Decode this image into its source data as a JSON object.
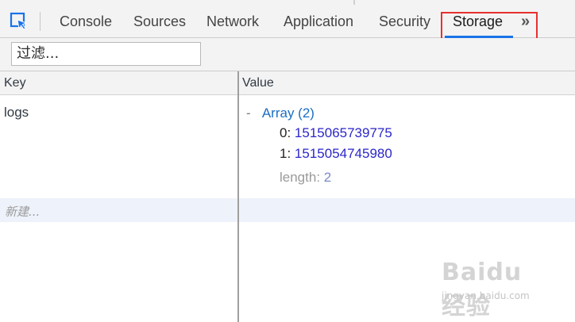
{
  "toolbar": {
    "tabs": [
      {
        "label": "Console"
      },
      {
        "label": "Sources"
      },
      {
        "label": "Network"
      },
      {
        "label": "Application"
      },
      {
        "label": "Security"
      },
      {
        "label": "Storage"
      }
    ],
    "active_tab": "Storage",
    "more_icon": "chevron-double-right-icon",
    "highlight_color": "#e8312f",
    "accent_color": "#1a73e8"
  },
  "filter": {
    "placeholder": "过滤..."
  },
  "table": {
    "headers": {
      "key": "Key",
      "value": "Value"
    },
    "rows": [
      {
        "key": "logs",
        "value": {
          "toggle": "-",
          "label": "Array (2)",
          "items": [
            {
              "index": "0:",
              "value": "1515065739775"
            },
            {
              "index": "1:",
              "value": "1515054745980"
            }
          ],
          "length_key": "length:",
          "length_value": "2"
        }
      }
    ],
    "new_row_placeholder": "新建..."
  },
  "watermark": {
    "brand": "Baidu 经验",
    "url": "jingyan.baidu.com"
  }
}
